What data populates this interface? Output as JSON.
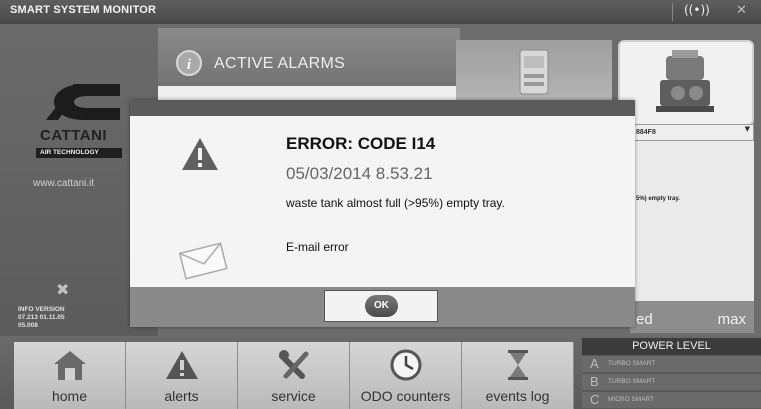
{
  "app": {
    "title": "SMART SYSTEM MONITOR"
  },
  "brand": {
    "name": "CATTANI",
    "tagline": "AIR TECHNOLOGY",
    "website": "www.cattani.it"
  },
  "info": {
    "label": "INFO VERSION",
    "line1": "07.213   01.11.05",
    "line2": "05.008"
  },
  "alarms": {
    "header": "ACTIVE ALARMS"
  },
  "device": {
    "selected": "884F8",
    "note": "5%) empty tray."
  },
  "level": {
    "left_label": "ed",
    "right_label": "max"
  },
  "dialog": {
    "title": "ERROR: CODE I14",
    "datetime": "05/03/2014 8.53.21",
    "description": "waste tank almost full (>95%) empty tray.",
    "email_status": "E-mail error",
    "ok_label": "OK"
  },
  "nav": [
    {
      "label": "home",
      "icon": "home-icon"
    },
    {
      "label": "alerts",
      "icon": "alert-icon"
    },
    {
      "label": "service",
      "icon": "tools-icon"
    },
    {
      "label": "ODO counters",
      "icon": "clock-icon"
    },
    {
      "label": "events log",
      "icon": "hourglass-icon"
    }
  ],
  "power_level": {
    "title": "POWER LEVEL",
    "options": [
      {
        "letter": "A",
        "name": "TURBO SMART"
      },
      {
        "letter": "B",
        "name": "TURBO SMART"
      },
      {
        "letter": "C",
        "name": "MICRO SMART"
      }
    ]
  }
}
